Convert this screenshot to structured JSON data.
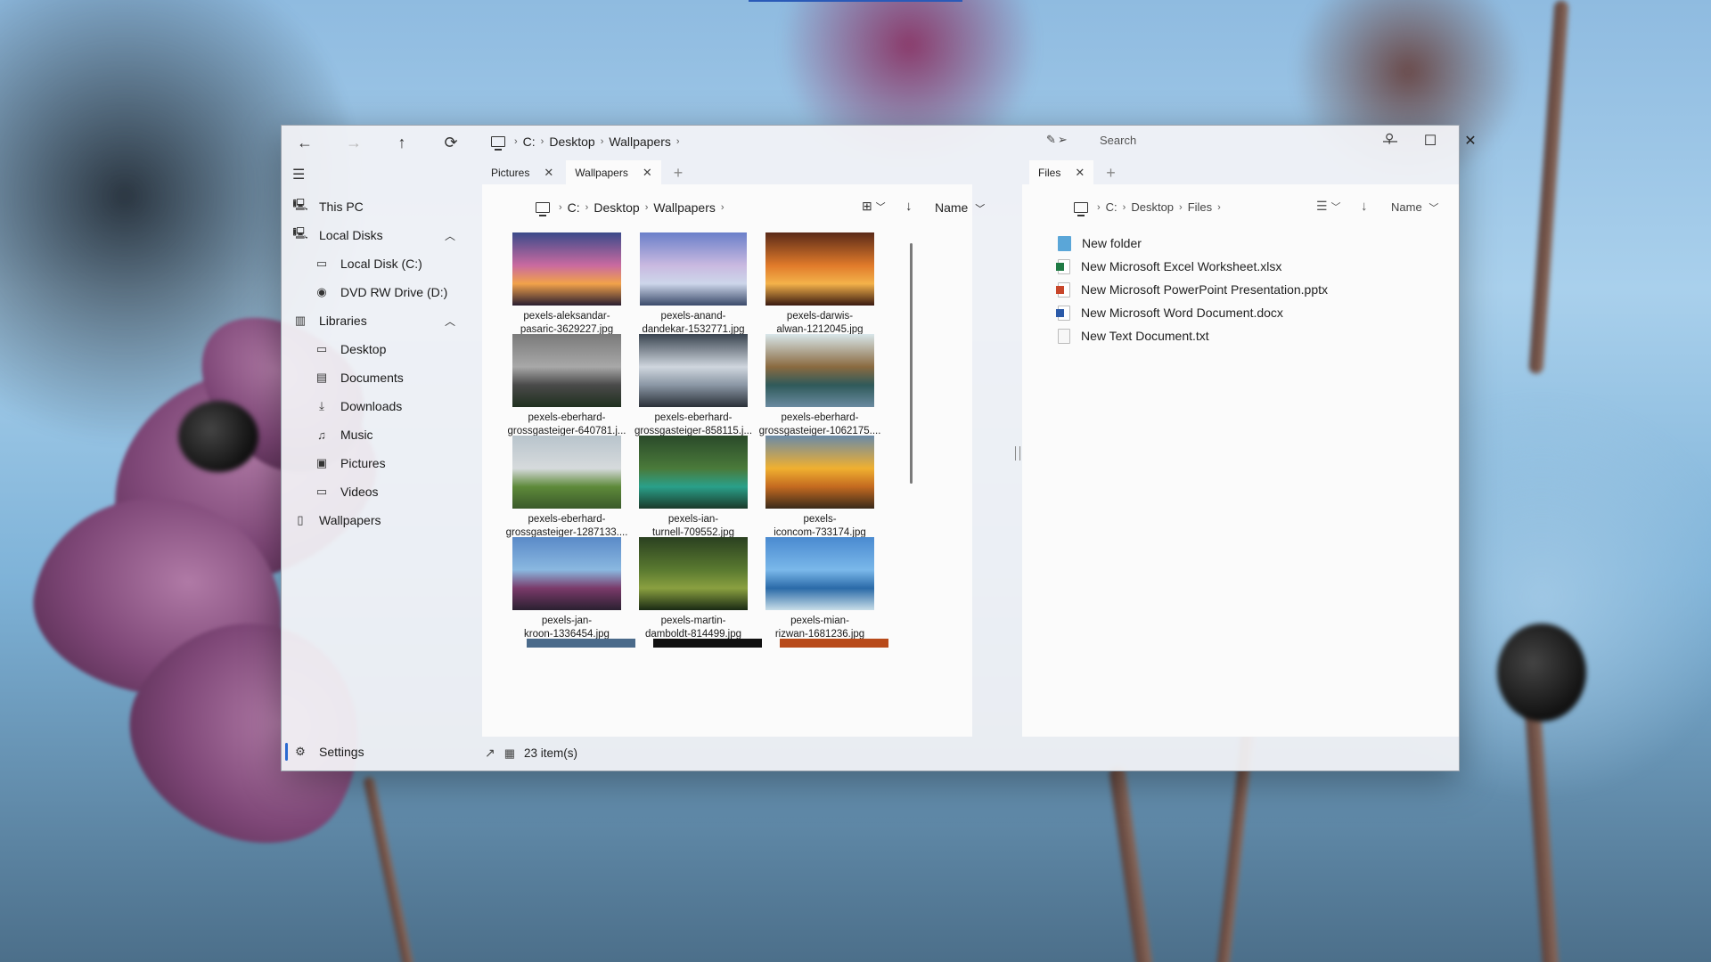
{
  "window": {
    "address": {
      "drive": "C:",
      "parts": [
        "Desktop",
        "Wallpapers"
      ]
    },
    "search_placeholder": "Search"
  },
  "sidebar": {
    "items": [
      {
        "label": "This PC"
      },
      {
        "label": "Local Disks"
      },
      {
        "label": "Local Disk (C:)"
      },
      {
        "label": "DVD RW Drive (D:)"
      },
      {
        "label": "Libraries"
      },
      {
        "label": "Desktop"
      },
      {
        "label": "Documents"
      },
      {
        "label": "Downloads"
      },
      {
        "label": "Music"
      },
      {
        "label": "Pictures"
      },
      {
        "label": "Videos"
      },
      {
        "label": "Wallpapers"
      }
    ],
    "settings_label": "Settings"
  },
  "left_pane": {
    "tabs": [
      {
        "label": "Pictures"
      },
      {
        "label": "Wallpapers"
      }
    ],
    "breadcrumb": {
      "drive": "C:",
      "parts": [
        "Desktop",
        "Wallpapers"
      ]
    },
    "sort_label": "Name",
    "tiles": [
      {
        "label": "pexels-aleksandar-\npasaric-3629227.jpg",
        "colors": [
          "#3a4a8a",
          "#c96aa0",
          "#f2a24a",
          "#2a1e30"
        ]
      },
      {
        "label": "pexels-anand-\ndandekar-1532771.jpg",
        "colors": [
          "#6a7fc9",
          "#c9b9e0",
          "#cdd6ea",
          "#3a4a6a"
        ]
      },
      {
        "label": "pexels-darwis-\nalwan-1212045.jpg",
        "colors": [
          "#5a2a18",
          "#e07a2a",
          "#f4b24a",
          "#3a1a10"
        ]
      },
      {
        "label": "pexels-eberhard-\ngrossgasteiger-640781.j...",
        "colors": [
          "#7a7a7a",
          "#a8a8a8",
          "#4a4a4a",
          "#20301f"
        ]
      },
      {
        "label": "pexels-eberhard-\ngrossgasteiger-858115.j...",
        "colors": [
          "#3a4450",
          "#cfd6de",
          "#8a96a4",
          "#2a3038"
        ]
      },
      {
        "label": "pexels-eberhard-\ngrossgasteiger-1062175....",
        "colors": [
          "#d8e6ea",
          "#8a6a40",
          "#2f5a5a",
          "#6a8aa0"
        ]
      },
      {
        "label": "pexels-eberhard-\ngrossgasteiger-1287133....",
        "colors": [
          "#b8c4cc",
          "#d6dadc",
          "#5e8a3a",
          "#3a5a2a"
        ]
      },
      {
        "label": "pexels-ian-\nturnell-709552.jpg",
        "colors": [
          "#2a4a2a",
          "#4a7a3a",
          "#2aa08a",
          "#1a3a2a"
        ]
      },
      {
        "label": "pexels-\niconcom-733174.jpg",
        "colors": [
          "#6a8aa8",
          "#f0b030",
          "#c46a20",
          "#3a2a1a"
        ]
      },
      {
        "label": "pexels-jan-\nkroon-1336454.jpg",
        "colors": [
          "#5a8ac8",
          "#8ab8e0",
          "#7a3a6a",
          "#2a2030"
        ]
      },
      {
        "label": "pexels-martin-\ndamboldt-814499.jpg",
        "colors": [
          "#2a4020",
          "#5a7a30",
          "#8aa040",
          "#1a2a14"
        ]
      },
      {
        "label": "pexels-mian-\nrizwan-1681236.jpg",
        "colors": [
          "#4a8ad0",
          "#7ab8ea",
          "#2a6aa8",
          "#c8dde8"
        ]
      }
    ],
    "partial_tile_colors": [
      "#4a6a8a",
      "#101010",
      "#b84a1a"
    ]
  },
  "status": {
    "items_text": "23 item(s)"
  },
  "right_pane": {
    "tabs": [
      {
        "label": "Files"
      }
    ],
    "breadcrumb": {
      "drive": "C:",
      "parts": [
        "Desktop",
        "Files"
      ]
    },
    "sort_label": "Name",
    "files": [
      {
        "name": "New folder",
        "type": "folder",
        "color": "#5aa6d8"
      },
      {
        "name": "New Microsoft Excel Worksheet.xlsx",
        "type": "excel",
        "color": "#1f7a44"
      },
      {
        "name": "New Microsoft PowerPoint Presentation.pptx",
        "type": "powerpoint",
        "color": "#c8462a"
      },
      {
        "name": "New Microsoft Word Document.docx",
        "type": "word",
        "color": "#2b5aa8"
      },
      {
        "name": "New Text Document.txt",
        "type": "text",
        "color": "#e6e6e6"
      }
    ]
  }
}
